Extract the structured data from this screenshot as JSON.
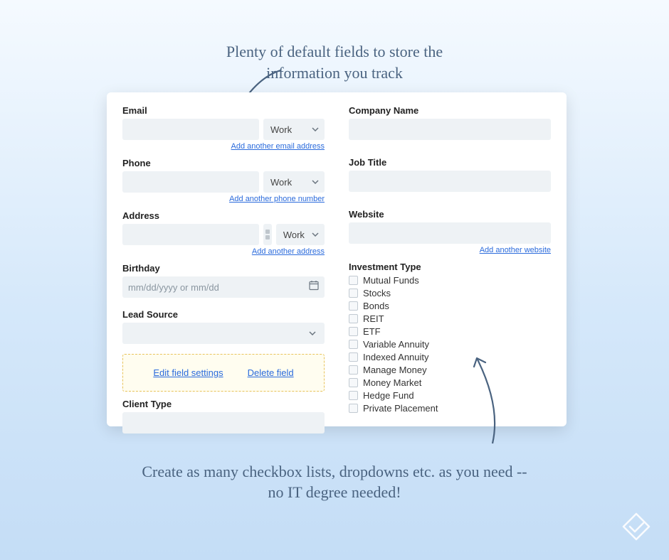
{
  "annotations": {
    "top_line1": "Plenty of default fields to store the",
    "top_line2": "information you track",
    "bottom_line1": "Create as many checkbox lists, dropdowns etc. as you need --",
    "bottom_line2": "no IT degree needed!"
  },
  "left": {
    "email": {
      "label": "Email",
      "type_value": "Work",
      "add_link": "Add another email address"
    },
    "phone": {
      "label": "Phone",
      "type_value": "Work",
      "add_link": "Add another phone number"
    },
    "address": {
      "label": "Address",
      "type_value": "Work",
      "add_link": "Add another address"
    },
    "birthday": {
      "label": "Birthday",
      "placeholder": "mm/dd/yyyy or mm/dd"
    },
    "lead_source": {
      "label": "Lead Source"
    },
    "edit_box": {
      "edit": "Edit field settings",
      "delete": "Delete field"
    },
    "client_type": {
      "label": "Client Type"
    }
  },
  "right": {
    "company": {
      "label": "Company Name"
    },
    "job": {
      "label": "Job Title"
    },
    "website": {
      "label": "Website",
      "add_link": "Add another website"
    },
    "investment": {
      "label": "Investment Type",
      "options": [
        "Mutual Funds",
        "Stocks",
        "Bonds",
        "REIT",
        "ETF",
        "Variable Annuity",
        "Indexed Annuity",
        "Manage Money",
        "Money Market",
        "Hedge Fund",
        "Private Placement"
      ]
    }
  }
}
